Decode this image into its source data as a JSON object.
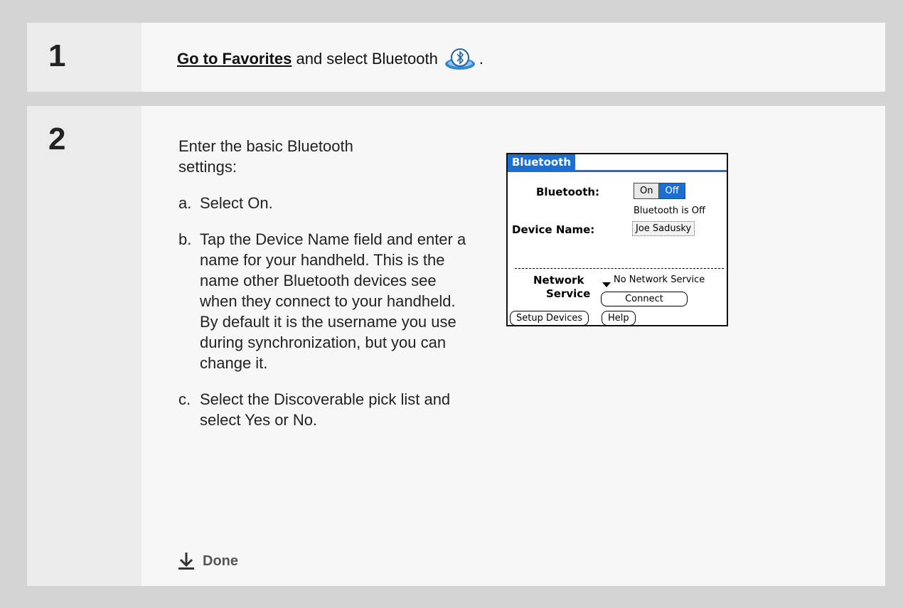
{
  "step1": {
    "number": "1",
    "link": "Go to Favorites",
    "text_before_icon": " and select Bluetooth",
    "text_after_icon": ".",
    "icon": "bluetooth-favorites-icon"
  },
  "step2": {
    "number": "2",
    "intro": "Enter the basic Bluetooth settings:",
    "items": [
      {
        "letter": "a.",
        "text": "Select On."
      },
      {
        "letter": "b.",
        "text": "Tap the Device Name field and enter a name for your handheld. This is the name other Bluetooth devices see when they connect to your handheld. By default it is the username you use during synchronization, but you can change it."
      },
      {
        "letter": "c.",
        "text": "Select the Discoverable pick list and select Yes or No."
      }
    ],
    "done_label": "Done"
  },
  "palm": {
    "title": "Bluetooth",
    "bluetooth_label": "Bluetooth:",
    "on_label": "On",
    "off_label": "Off",
    "status": "Bluetooth is Off",
    "device_name_label": "Device Name:",
    "device_name_value": "Joe Sadusky",
    "network_label": "Network",
    "service_label": "Service",
    "network_value": "No Network Service",
    "connect_button": "Connect",
    "setup_button": "Setup Devices",
    "help_button": "Help"
  },
  "colors": {
    "accent": "#1c6fd0",
    "page_bg": "#d4d4d4"
  }
}
